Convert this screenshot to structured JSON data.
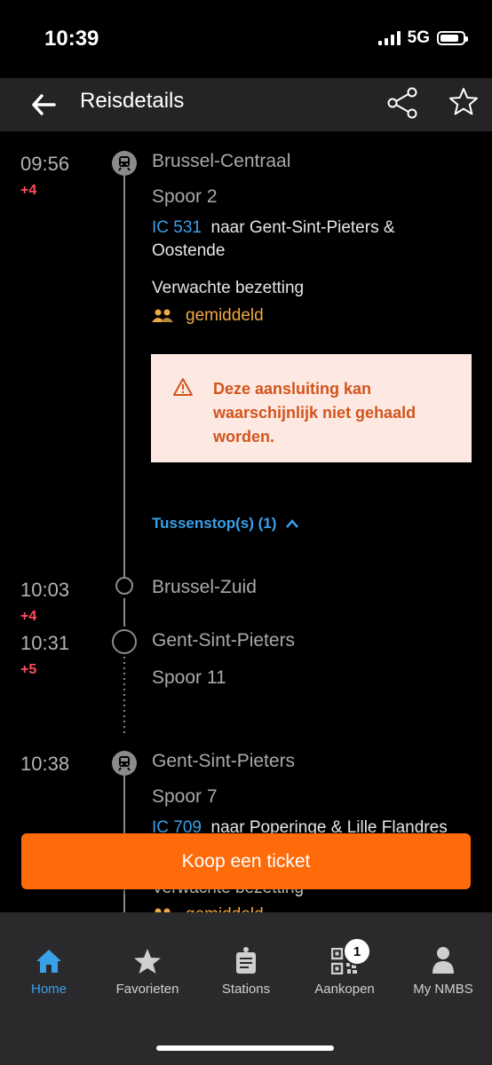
{
  "status": {
    "time": "10:39",
    "network": "5G",
    "battery_level": 0.85
  },
  "header": {
    "title": "Reisdetails"
  },
  "stops": [
    {
      "time": "09:56",
      "delay": "+4",
      "station": "Brussel-Centraal",
      "platform": "Spoor 2"
    },
    {
      "time": "10:03",
      "delay": "+4",
      "station": "Brussel-Zuid"
    },
    {
      "time": "10:31",
      "delay": "+5",
      "station": "Gent-Sint-Pieters",
      "platform": "Spoor 11"
    },
    {
      "time": "10:38",
      "station": "Gent-Sint-Pieters",
      "platform": "Spoor 7"
    }
  ],
  "train1": {
    "number": "IC 531",
    "direction": "naar Gent-Sint-Pieters & Oostende",
    "occupancy_label": "Verwachte bezetting",
    "occupancy_value": "gemiddeld"
  },
  "train2": {
    "number": "IC 709",
    "direction": "naar Poperinge & Lille Flandres",
    "occupancy_label": "Verwachte bezetting",
    "occupancy_value": "gemiddeld"
  },
  "warning": {
    "text": "Deze aansluiting kan waarschijnlijk niet gehaald worden."
  },
  "intermediate": {
    "label": "Tussenstop(s) (1)"
  },
  "cta": {
    "label": "Koop een ticket"
  },
  "tabs": [
    {
      "label": "Home",
      "icon": "home-icon",
      "active": true
    },
    {
      "label": "Favorieten",
      "icon": "star-icon"
    },
    {
      "label": "Stations",
      "icon": "stations-icon"
    },
    {
      "label": "Aankopen",
      "icon": "qr-code-icon",
      "badge": "1"
    },
    {
      "label": "My NMBS",
      "icon": "user-icon"
    }
  ],
  "colors": {
    "accent": "#3aa0e8",
    "cta": "#ff6b0a",
    "delay": "#ff4d5e",
    "warning_bg": "#fde9e1",
    "warning_text": "#d2541e",
    "occupancy": "#f0a845"
  }
}
